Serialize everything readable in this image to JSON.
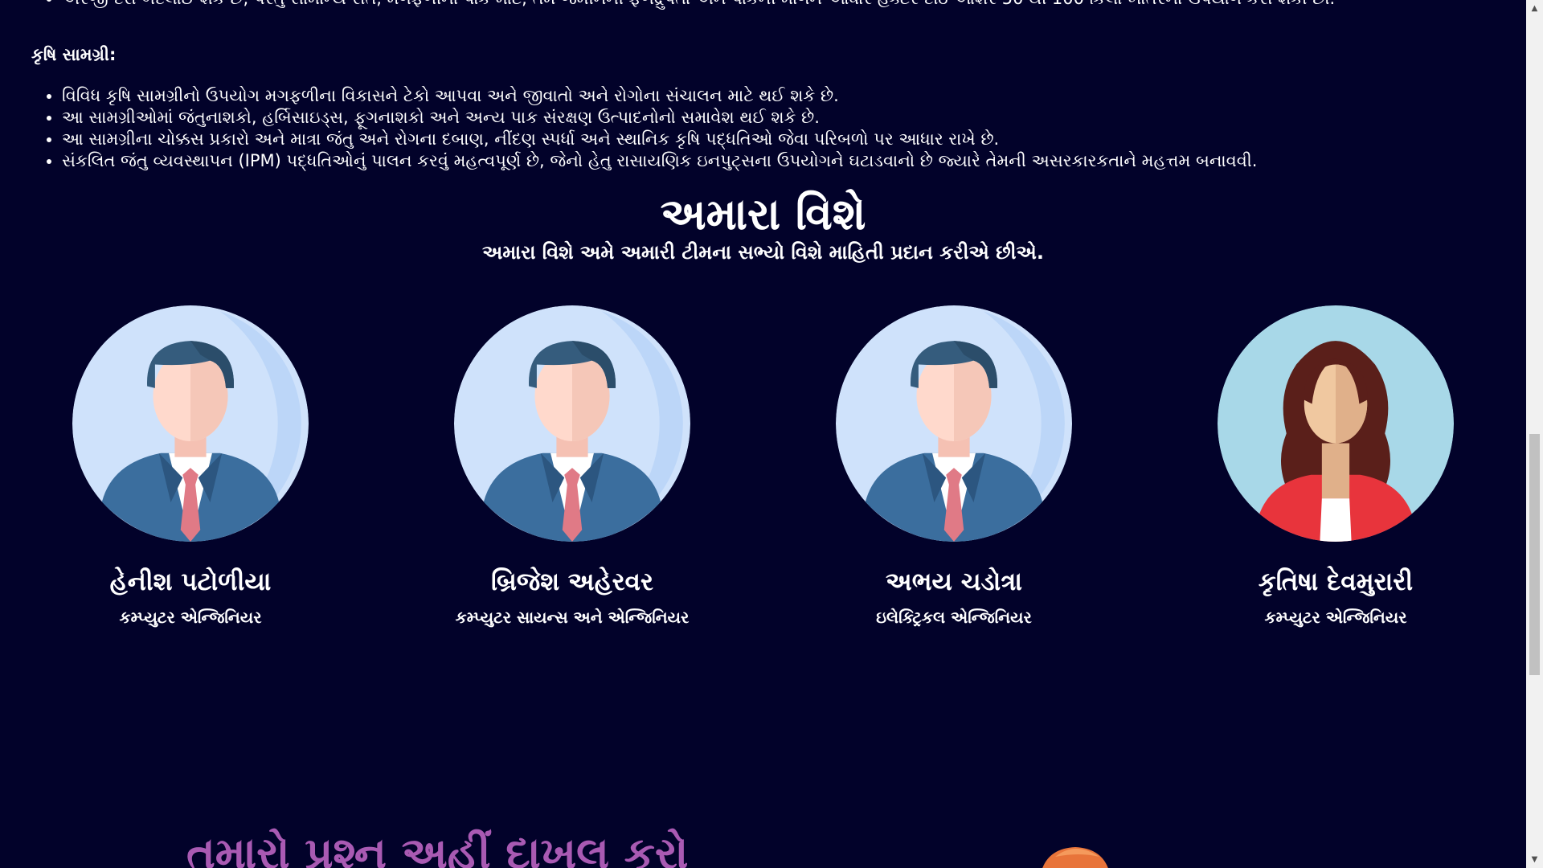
{
  "fertilizer_bullets": [
    "અરજી દરો બદલાઈ શકે છે, પરંતુ સામાન્ય રીતે, મગફળીના પાક માટે, તમે જમીનની ફળદ્રુપતા અને પાકની માંગને આધારે હેક્ટર દીઠ આશરે 50 થી 100 કિલો ખાતરનો ઉપયોગ કરી શકો છો."
  ],
  "materials": {
    "heading": "કૃષિ સામગ્રી:",
    "bullets": [
      "વિવિધ કૃષિ સામગ્રીનો ઉપયોગ મગફળીના વિકાસને ટેકો આપવા અને જીવાતો અને રોગોના સંચાલન માટે થઈ શકે છે.",
      "આ સામગ્રીઓમાં જંતુનાશકો, હર્બિસાઇડ્સ, ફૂગનાશકો અને અન્ય પાક સંરક્ષણ ઉત્પાદનોનો સમાવેશ થઈ શકે છે.",
      "આ સામગ્રીના ચોક્કસ પ્રકારો અને માત્રા જંતુ અને રોગના દબાણ, નીંદણ સ્પર્ધા અને સ્થાનિક કૃષિ પદ્ધતિઓ જેવા પરિબળો પર આધાર રાખે છે.",
      "સંકલિત જંતુ વ્યવસ્થાપન (IPM) પદ્ધતિઓનું પાલન કરવું મહત્વપૂર્ણ છે, જેનો હેતુ રાસાયણિક ઇનપુટ્સના ઉપયોગને ઘટાડવાનો છે જ્યારે તેમની અસરકારકતાને મહત્તમ બનાવવી."
    ]
  },
  "about": {
    "title": "અમારા વિશે",
    "subtitle": "અમારા વિશે અમે અમારી ટીમના સભ્યો વિશે માહિતી પ્રદાન કરીએ છીએ."
  },
  "team": [
    {
      "name": "હેનીશ પટોળીયા",
      "role": "કમ્પ્યુટર એન્જિનિયર",
      "avatar": "male-avatar-icon"
    },
    {
      "name": "બ્રિજેશ અહેરવર",
      "role": "કમ્પ્યુટર સાયન્સ અને એન્જિનિયર",
      "avatar": "male-avatar-icon"
    },
    {
      "name": "અભય ચડોત્રા",
      "role": "ઇલેક્ટ્રિકલ એન્જિનિયર",
      "avatar": "male-avatar-icon"
    },
    {
      "name": "કૃતિષા દેવમુરારી",
      "role": "કમ્પ્યુટર એન્જિનિયર",
      "avatar": "female-avatar-icon"
    }
  ],
  "question": {
    "title": "તમારો પ્રશ્ન અહીં દાખલ કરો"
  },
  "colors": {
    "background": "#02022a",
    "question_title": "#a95ab3",
    "avatar_male_bg": "#cfe2fb",
    "avatar_female_bg": "#a8d8e8"
  }
}
